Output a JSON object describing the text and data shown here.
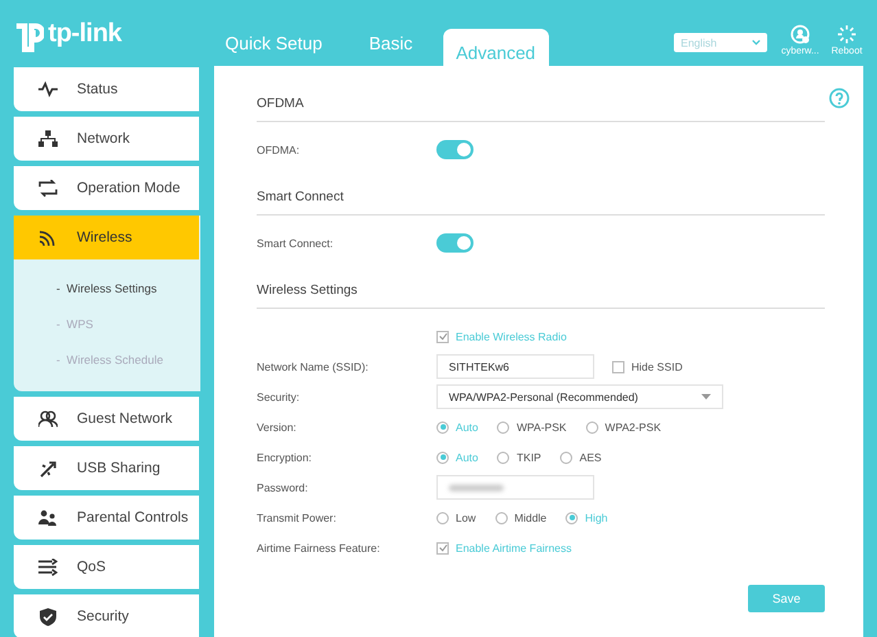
{
  "header": {
    "logo": "tp-link",
    "tabs": [
      {
        "label": "Quick Setup",
        "selected": false
      },
      {
        "label": "Basic",
        "selected": false
      },
      {
        "label": "Advanced",
        "selected": true
      }
    ],
    "language": "English",
    "actions": [
      {
        "label": "cyberw...",
        "kind": "user"
      },
      {
        "label": "Reboot",
        "kind": "reboot"
      }
    ]
  },
  "sidebar": {
    "items": [
      {
        "label": "Status",
        "selected": false
      },
      {
        "label": "Network",
        "selected": false
      },
      {
        "label": "Operation Mode",
        "selected": false
      },
      {
        "label": "Wireless",
        "selected": true,
        "expanded": true,
        "children": [
          {
            "label": "-  Wireless Settings",
            "selected": true
          },
          {
            "label": "-  WPS",
            "selected": false
          },
          {
            "label": "-  Wireless Schedule",
            "selected": false
          }
        ]
      },
      {
        "label": "Guest Network",
        "selected": false
      },
      {
        "label": "USB Sharing",
        "selected": false
      },
      {
        "label": "Parental Controls",
        "selected": false
      },
      {
        "label": "QoS",
        "selected": false
      },
      {
        "label": "Security",
        "selected": false
      }
    ]
  },
  "sections": [
    {
      "title": "OFDMA",
      "rows": [
        {
          "kind": "toggle",
          "label": "OFDMA:",
          "on": true
        }
      ]
    },
    {
      "title": "Smart Connect",
      "rows": [
        {
          "kind": "toggle",
          "label": "Smart Connect:",
          "on": true
        }
      ]
    },
    {
      "title": "Wireless Settings",
      "rows": [
        {
          "kind": "checkbox",
          "option": "Enable Wireless Radio",
          "checked": true
        },
        {
          "kind": "text",
          "label": "Network Name (SSID):",
          "value": "SITHTEKw6",
          "extra": {
            "option": "Hide SSID",
            "checked": false
          }
        },
        {
          "kind": "select",
          "label": "Security:",
          "value": "WPA/WPA2-Personal (Recommended)"
        },
        {
          "kind": "radio",
          "label": "Version:",
          "options": [
            {
              "label": "Auto",
              "selected": true
            },
            {
              "label": "WPA-PSK",
              "selected": false
            },
            {
              "label": "WPA2-PSK",
              "selected": false
            }
          ]
        },
        {
          "kind": "radio",
          "label": "Encryption:",
          "options": [
            {
              "label": "Auto",
              "selected": true
            },
            {
              "label": "TKIP",
              "selected": false
            },
            {
              "label": "AES",
              "selected": false
            }
          ]
        },
        {
          "kind": "password",
          "label": "Password:"
        },
        {
          "kind": "radio",
          "label": "Transmit Power:",
          "options": [
            {
              "label": "Low",
              "selected": false
            },
            {
              "label": "Middle",
              "selected": false
            },
            {
              "label": "High",
              "selected": true
            }
          ]
        },
        {
          "kind": "checkbox",
          "label": "Airtime Fairness Feature:",
          "option": "Enable Airtime Fairness",
          "checked": true
        }
      ]
    }
  ],
  "save": "Save"
}
